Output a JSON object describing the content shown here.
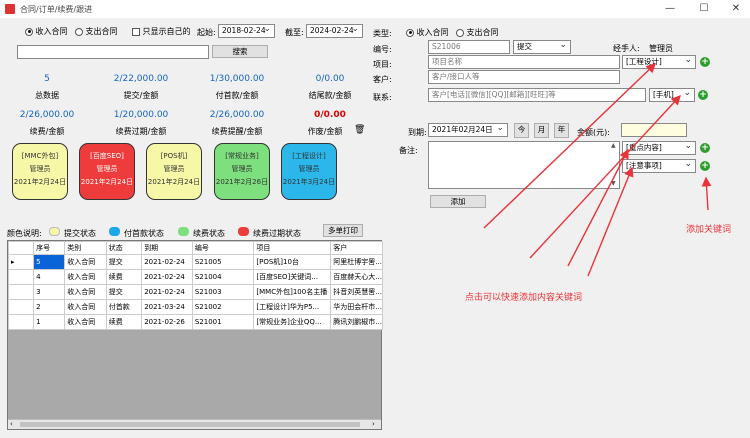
{
  "window": {
    "title": "合同/订单/续费/跟进",
    "min": "—",
    "max": "☐",
    "close": "✕"
  },
  "filter": {
    "radio_income": "收入合同",
    "radio_expense": "支出合同",
    "only_mine": "只显示自己的",
    "start_label": "起始:",
    "start_date": "2018-02-24",
    "end_label": "截至:",
    "end_date": "2024-02-24",
    "search_button": "搜索"
  },
  "stats": [
    {
      "value": "5",
      "label": "总数据"
    },
    {
      "value": "2/22,000.00",
      "label": "提交/金额"
    },
    {
      "value": "1/30,000.00",
      "label": "付首款/金额"
    },
    {
      "value": "0/0.00",
      "label": "结尾款/金额"
    },
    {
      "value": "2/26,000.00",
      "label": "续费/金额"
    },
    {
      "value": "1/20,000.00",
      "label": "续费过期/金额"
    },
    {
      "value": "2/26,000.00",
      "label": "续费提醒/金额"
    },
    {
      "value": "0/0.00",
      "label": "作废/金额"
    }
  ],
  "cards": [
    {
      "tag": "[MMC外包]",
      "user": "管理员",
      "date": "2021年2月24日",
      "color": "#f7f7a8",
      "text_color": "#333"
    },
    {
      "tag": "[百度SEO]",
      "user": "管理员",
      "date": "2021年2月24日",
      "color": "#ee3b3b",
      "text_color": "#fff"
    },
    {
      "tag": "[POS机]",
      "user": "管理员",
      "date": "2021年2月24日",
      "color": "#f7f7a8",
      "text_color": "#333"
    },
    {
      "tag": "[常规业务]",
      "user": "管理员",
      "date": "2021年2月26日",
      "color": "#7ddf7d",
      "text_color": "#333"
    },
    {
      "tag": "[工程设计]",
      "user": "管理员",
      "date": "2021年3月24日",
      "color": "#2bb7ea",
      "text_color": "#333"
    }
  ],
  "legend": {
    "label": "颜色说明:",
    "items": [
      {
        "name": "提交状态",
        "color": "#f7f7a8"
      },
      {
        "name": "付首款状态",
        "color": "#1aa9e8"
      },
      {
        "name": "续费状态",
        "color": "#7ddf7d"
      },
      {
        "name": "续费过期状态",
        "color": "#ee3b3b"
      }
    ],
    "print_button": "多单打印"
  },
  "table": {
    "headers": [
      "序号",
      "类别",
      "状态",
      "到期",
      "编号",
      "项目",
      "客户"
    ],
    "rows": [
      [
        "5",
        "收入合同",
        "提交",
        "2021-02-24",
        "S21005",
        "[POS机]10台",
        "阿里杜博宇罟..."
      ],
      [
        "4",
        "收入合同",
        "续费",
        "2021-02-24",
        "S21004",
        "[百度SEO]关键词...",
        "百度赫天心大..."
      ],
      [
        "3",
        "收入合同",
        "提交",
        "2021-02-24",
        "S21003",
        "[MMC外包]100名主播",
        "抖音刘英慧罟..."
      ],
      [
        "2",
        "收入合同",
        "付首款",
        "2021-03-24",
        "S21002",
        "[工程设计]华为P5...",
        "华为田会杆市..."
      ],
      [
        "1",
        "收入合同",
        "续费",
        "2021-02-26",
        "S21001",
        "[常规业务]企业QQ...",
        "腾讯刘鹏椒市..."
      ]
    ]
  },
  "form": {
    "type_label": "类型:",
    "radio_income": "收入合同",
    "radio_expense": "支出合同",
    "number_label": "编号:",
    "number_value": "S21006",
    "status_value": "提交",
    "handler_label": "经手人:",
    "handler_value": "管理员",
    "project_label": "项目:",
    "project_placeholder": "项目名称",
    "project_tag": "[工程设计]",
    "customer_label": "客户:",
    "customer_placeholder": "客户/接口人等",
    "contact_label": "联系:",
    "contact_placeholder": "客户[电话][微信][QQ][邮箱][旺旺]等",
    "contact_type": "[手机]",
    "due_label": "到期:",
    "due_value": "2021年02月24日",
    "today_button": "今",
    "month_button": "月",
    "year_button": "年",
    "amount_label": "金额(元):",
    "note_label": "备注:",
    "note_tag1": "[重点内容]",
    "note_tag2": "[注意事项]",
    "add_button": "添加"
  },
  "annotations": {
    "add_keyword": "添加关键词",
    "click_hint": "点击可以快速添加内容关键词"
  },
  "colors": {
    "accent_blue": "#1565c0",
    "annotation_red": "#e8333a",
    "plus_green": "#2e9e2e"
  }
}
